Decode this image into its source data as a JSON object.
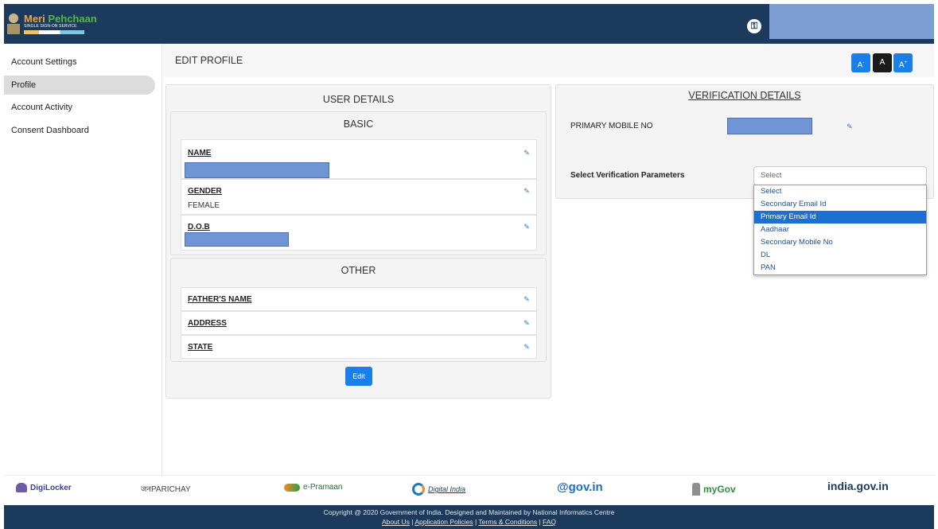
{
  "header": {
    "logo": {
      "name_part1": "Meri",
      "name_part2": " Pehchaan",
      "subtitle": "SINGLE SIGN-ON SERVICE"
    }
  },
  "sidebar": {
    "items": [
      {
        "label": "Account Settings",
        "active": false
      },
      {
        "label": "Profile",
        "active": true
      },
      {
        "label": "Account Activity",
        "active": false
      },
      {
        "label": "Consent Dashboard",
        "active": false
      }
    ]
  },
  "page": {
    "title": "EDIT PROFILE",
    "font_controls": {
      "small": "A",
      "normal": "A",
      "large": "A"
    }
  },
  "user_details": {
    "title": "USER DETAILS",
    "basic": {
      "title": "BASIC",
      "fields": [
        {
          "label": "NAME",
          "value": ""
        },
        {
          "label": "GENDER",
          "value": "FEMALE"
        },
        {
          "label": "D.O.B",
          "value": ""
        }
      ]
    },
    "other": {
      "title": "OTHER",
      "fields": [
        {
          "label": "FATHER'S NAME"
        },
        {
          "label": "ADDRESS"
        },
        {
          "label": "STATE"
        }
      ]
    },
    "edit_button": "Edit"
  },
  "verification": {
    "title": "VERIFICATION DETAILS",
    "primary_mobile_label": "PRIMARY MOBILE NO",
    "select_label": "Select Verification Parameters",
    "select_value": "Select",
    "options": [
      "Select",
      "Secondary Email Id",
      "Primary Email Id",
      "Aadhaar",
      "Secondary Mobile No",
      "DL",
      "PAN"
    ],
    "highlighted_option": "Primary Email Id"
  },
  "footer_logos": [
    "DigiLocker",
    "जनPARICHAY",
    "e-Pramaan",
    "Digital India",
    "@gov.in",
    "myGov",
    "india.gov.in"
  ],
  "footer": {
    "copyright": "Copyright @ 2020 Government of India. Designed and Maintained by National Informatics Centre",
    "links": [
      "About Us",
      "Application Policies",
      "Terms & Conditions",
      "FAQ"
    ]
  },
  "colors": {
    "header_bg": "#1b3a5c",
    "accent_blue": "#1a7fe8",
    "redaction": "#6f95d5",
    "dropdown_highlight": "#1e6fcf"
  }
}
